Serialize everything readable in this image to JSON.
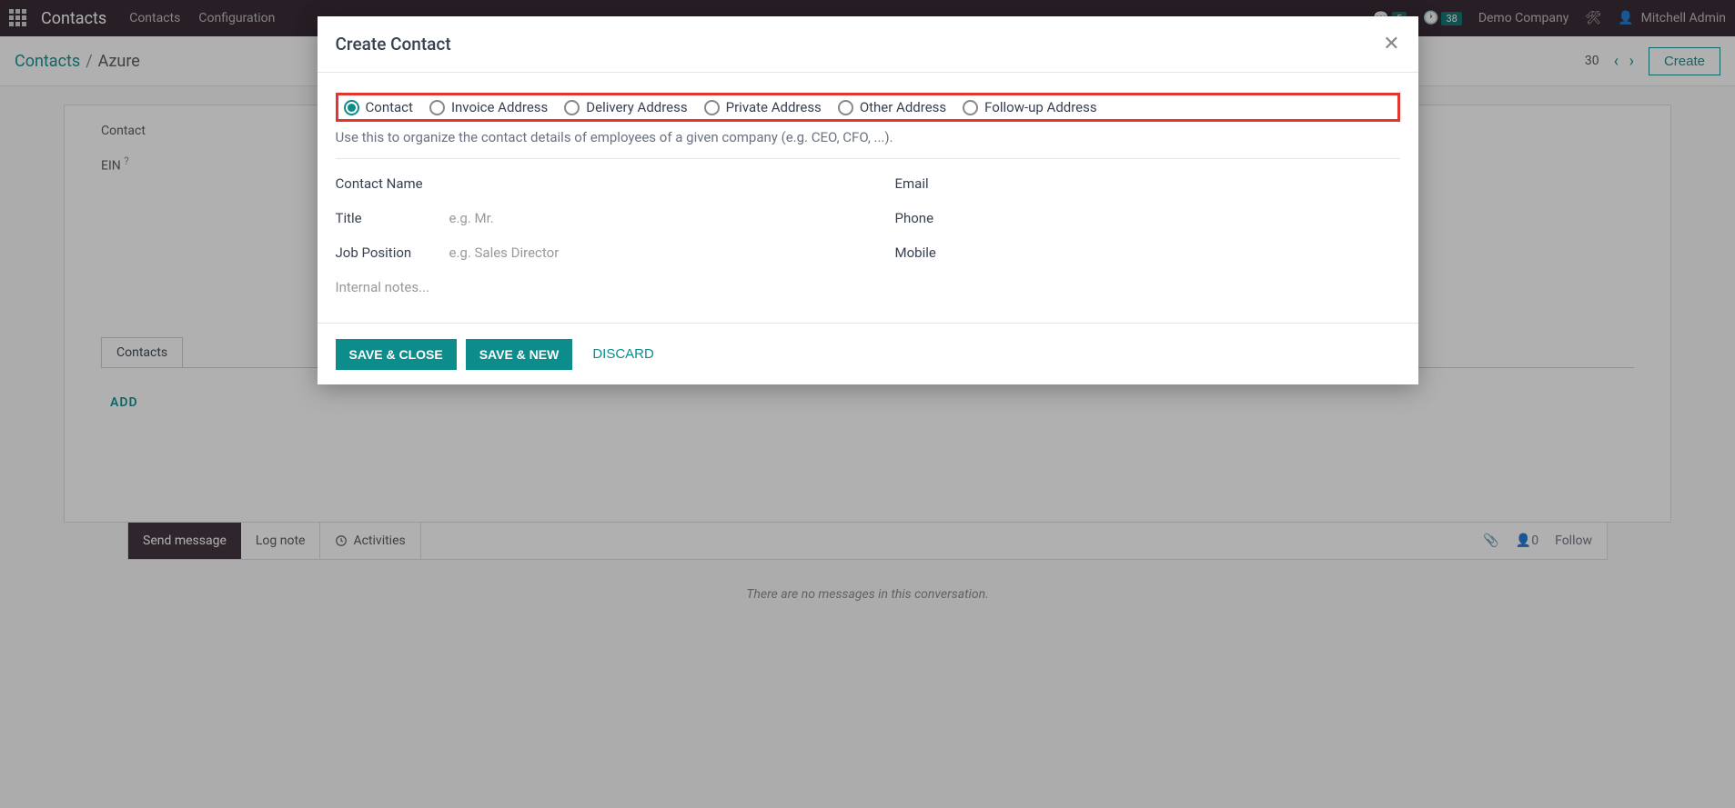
{
  "topnav": {
    "brand": "Contacts",
    "links": [
      "Contacts",
      "Configuration"
    ],
    "msg_count": "5",
    "clock_count": "38",
    "company": "Demo Company",
    "user": "Mitchell Admin"
  },
  "breadcrumb": {
    "root": "Contacts",
    "sep": "/",
    "current": "Azure",
    "pager_suffix": "30",
    "create": "Create"
  },
  "bgform": {
    "label_contact": "Contact",
    "label_ein": "EIN",
    "ein_help": "?",
    "tab_contacts": "Contacts",
    "add": "ADD"
  },
  "chatter": {
    "send": "Send message",
    "log": "Log note",
    "activities": "Activities",
    "follow_count": "0",
    "follow": "Follow",
    "empty": "There are no messages in this conversation."
  },
  "modal": {
    "title": "Create Contact",
    "radios": [
      "Contact",
      "Invoice Address",
      "Delivery Address",
      "Private Address",
      "Other Address",
      "Follow-up Address"
    ],
    "selected_radio": 0,
    "help": "Use this to organize the contact details of employees of a given company (e.g. CEO, CFO, ...).",
    "left_fields": {
      "contact_name": "Contact Name",
      "title": "Title",
      "title_ph": "e.g. Mr.",
      "job": "Job Position",
      "job_ph": "e.g. Sales Director"
    },
    "right_fields": {
      "email": "Email",
      "phone": "Phone",
      "mobile": "Mobile"
    },
    "notes_ph": "Internal notes...",
    "buttons": {
      "save_close": "SAVE & CLOSE",
      "save_new": "SAVE & NEW",
      "discard": "DISCARD"
    }
  }
}
